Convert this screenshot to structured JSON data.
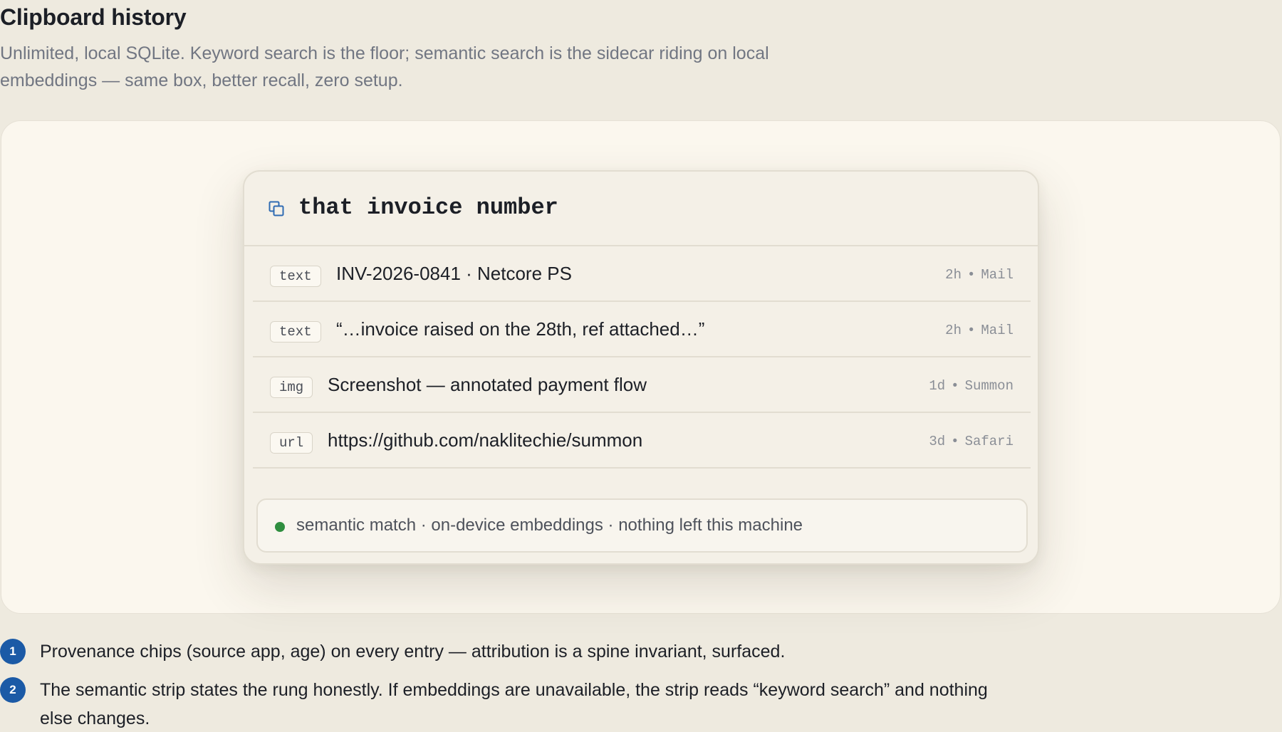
{
  "header": {
    "title": "Clipboard history",
    "subtitle": "Unlimited, local SQLite. Keyword search is the floor; semantic search is the sidecar riding on local embeddings — same box, better recall, zero setup."
  },
  "palette": {
    "icon": "clipboard-copy-icon",
    "search_value": "that invoice number",
    "results": [
      {
        "kind": "text",
        "content": "INV-2026-0841 · Netcore PS",
        "age": "2h",
        "separator": "•",
        "source": "Mail"
      },
      {
        "kind": "text",
        "content": "“…invoice raised on the 28th, ref attached…”",
        "age": "2h",
        "separator": "•",
        "source": "Mail"
      },
      {
        "kind": "img",
        "content": "Screenshot — annotated payment flow",
        "age": "1d",
        "separator": "•",
        "source": "Summon"
      },
      {
        "kind": "url",
        "content": "https://github.com/naklitechie/summon",
        "age": "3d",
        "separator": "•",
        "source": "Safari"
      }
    ],
    "status": {
      "text": "semantic match · on-device embeddings · nothing left this machine",
      "dot_color": "#2f8e3f"
    }
  },
  "notes": [
    {
      "number": "1",
      "text": "Provenance chips (source app, age) on every entry — attribution is a spine invariant, surfaced."
    },
    {
      "number": "2",
      "text": "The semantic strip states the rung honestly. If embeddings are unavailable, the strip reads “keyword search” and nothing else changes."
    }
  ],
  "colors": {
    "background": "#eeeadf",
    "stage": "#fbf7ee",
    "accent_blue": "#1b5aa6",
    "status_green": "#2f8e3f"
  }
}
